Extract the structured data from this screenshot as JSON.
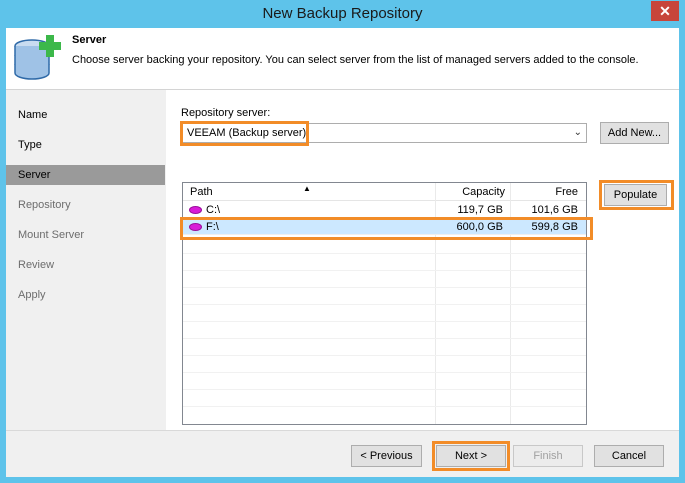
{
  "window": {
    "title": "New Backup Repository",
    "close_glyph": "✕"
  },
  "header": {
    "title": "Server",
    "description": "Choose server backing your repository. You can select server from the list of managed servers added to the console.",
    "icon": "database-add-icon"
  },
  "nav": {
    "items": [
      {
        "label": "Name"
      },
      {
        "label": "Type"
      },
      {
        "label": "Server"
      },
      {
        "label": "Repository"
      },
      {
        "label": "Mount Server"
      },
      {
        "label": "Review"
      },
      {
        "label": "Apply"
      }
    ]
  },
  "repository_server": {
    "label": "Repository server:",
    "value": "VEEAM (Backup server)",
    "add_new_label": "Add New...",
    "populate_label": "Populate"
  },
  "table": {
    "columns": [
      "Path",
      "Capacity",
      "Free"
    ],
    "rows": [
      {
        "path": "C:\\",
        "capacity": "119,7 GB",
        "free": "101,6 GB",
        "icon": "disk-icon"
      },
      {
        "path": "F:\\",
        "capacity": "600,0 GB",
        "free": "599,8 GB",
        "icon": "disk-icon"
      }
    ]
  },
  "footer": {
    "previous_label": "< Previous",
    "next_label": "Next >",
    "finish_label": "Finish",
    "cancel_label": "Cancel"
  },
  "colors": {
    "highlight": "#f28c28",
    "selection": "#cce8ff",
    "titlebar": "#5ec3ea"
  }
}
